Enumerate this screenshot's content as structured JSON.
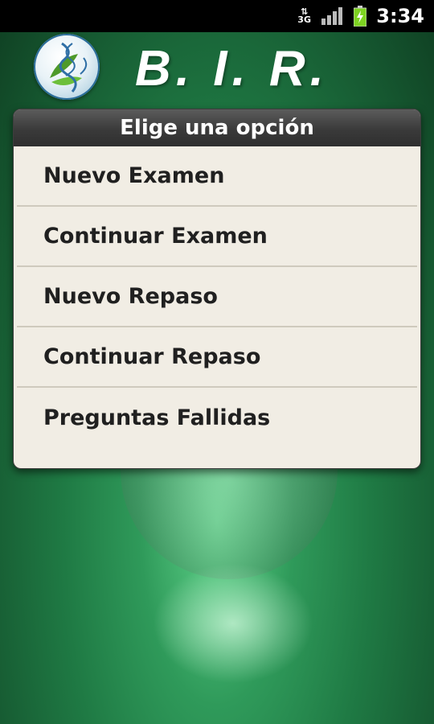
{
  "status_bar": {
    "network": "3G",
    "time": "3:34",
    "icons": [
      "3g-data-icon",
      "signal-icon",
      "battery-icon"
    ]
  },
  "header": {
    "title": "B. I. R.",
    "logo_icon": "dna-leaf-logo"
  },
  "dialog": {
    "title": "Elige una opción",
    "options": [
      {
        "label": "Nuevo Examen"
      },
      {
        "label": "Continuar Examen"
      },
      {
        "label": "Nuevo Repaso"
      },
      {
        "label": "Continuar Repaso"
      },
      {
        "label": "Preguntas Fallidas"
      }
    ]
  },
  "colors": {
    "background": "#1f7a44",
    "dialog_bg": "#f1ede4",
    "dialog_title_bg": "#3a3a3a",
    "battery": "#7ed321"
  }
}
